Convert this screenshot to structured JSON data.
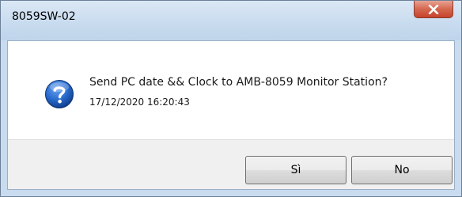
{
  "window": {
    "title": "8059SW-02",
    "close_icon": "close-icon"
  },
  "dialog": {
    "icon": "question-icon",
    "message": "Send PC date && Clock to AMB-8059 Monitor Station?",
    "datetime": "17/12/2020 16:20:43"
  },
  "buttons": {
    "yes_label": "Sì",
    "no_label": "No"
  },
  "colors": {
    "title_bar": "#c9dcef",
    "close_button": "#c7432b",
    "question_icon": "#1f5fbf",
    "footer": "#f0f0f0"
  }
}
